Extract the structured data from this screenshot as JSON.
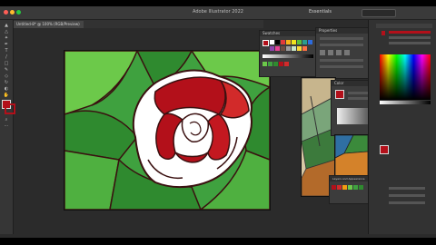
{
  "app": {
    "title": "Adobe Illustrator 2022",
    "workspace": "Essentials",
    "doc_tab": "Untitled-8* @ 100% (RGB/Preview)"
  },
  "panels": {
    "swatches_title": "Swatches",
    "properties_title": "Properties",
    "color_title": "Color",
    "layers_title": "Layers and Appearance"
  },
  "colors": {
    "accent_red": "#b3101a",
    "leaf_dark": "#2f8a2f",
    "leaf_mid": "#3fa13f",
    "leaf_light": "#6cc94a",
    "outline": "#4a0a0a"
  },
  "tools": [
    "selection-tool",
    "direct-selection-tool",
    "magic-wand-tool",
    "pen-tool",
    "type-tool",
    "line-tool",
    "rectangle-tool",
    "paintbrush-tool",
    "pencil-tool",
    "eraser-tool",
    "rotate-tool",
    "scale-tool",
    "width-tool",
    "free-transform-tool",
    "shape-builder-tool",
    "perspective-tool",
    "mesh-tool",
    "gradient-tool",
    "eyedropper-tool",
    "blend-tool",
    "symbol-sprayer-tool",
    "graph-tool",
    "artboard-tool",
    "slice-tool",
    "hand-tool",
    "zoom-tool"
  ]
}
